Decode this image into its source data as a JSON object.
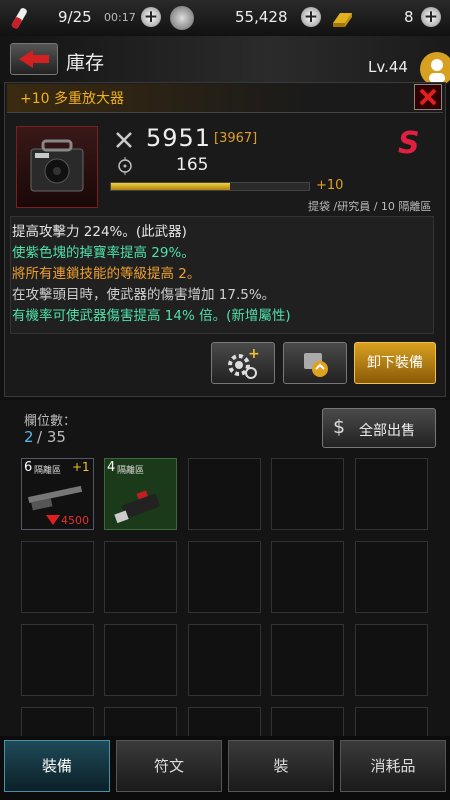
{
  "status_bar": {
    "energy": "9/25",
    "timer": "00:17",
    "coins": "55,428",
    "gold": "8"
  },
  "header": {
    "title": "庫存",
    "level": "Lv.44"
  },
  "item": {
    "name": "+10 多重放大器",
    "attack": "5951",
    "attack_bonus": "[3967]",
    "accuracy": "165",
    "upgrade_label": "+10",
    "upgrade_progress": 0.6,
    "source": "提袋 /研究員 / 10 隔離區",
    "rarity_badge": "S",
    "stats": [
      {
        "text": "提高攻擊力 224%。(此武器)",
        "color": "#e6e6e6"
      },
      {
        "text": "使紫色塊的掉寶率提高 29%。",
        "color": "#4fe0a8"
      },
      {
        "text": "將所有連鎖技能的等級提高 2。",
        "color": "#f0a030"
      },
      {
        "text": "在攻擊頭目時，使武器的傷害增加 17.5%。",
        "color": "#cfcfcf"
      },
      {
        "text": "有機率可使武器傷害提高 14% 倍。(新增屬性)",
        "color": "#4fe0a8"
      }
    ],
    "unequip_label": "卸下裝備"
  },
  "inventory": {
    "slots_label": "欄位數：",
    "slots_used": "2",
    "slots_total": "/ 35",
    "sell_all_label": "全部出售",
    "items": [
      {
        "zone": "6",
        "zone_label": "隔離區",
        "plus": "+1",
        "power": "4500"
      },
      {
        "zone": "4",
        "zone_label": "隔離區"
      }
    ]
  },
  "tabs": [
    {
      "label": "裝備"
    },
    {
      "label": "符文"
    },
    {
      "label": "裝"
    },
    {
      "label": "消耗品"
    }
  ]
}
